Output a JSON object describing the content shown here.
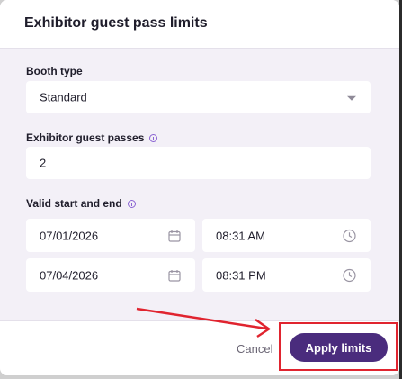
{
  "dialog": {
    "title": "Exhibitor guest pass limits"
  },
  "booth_type": {
    "label": "Booth type",
    "value": "Standard"
  },
  "guest_passes": {
    "label": "Exhibitor guest passes",
    "value": "2"
  },
  "validity": {
    "label": "Valid start and end",
    "start_date": "07/01/2026",
    "start_time": "08:31 AM",
    "end_date": "07/04/2026",
    "end_time": "08:31 PM"
  },
  "footer": {
    "cancel_label": "Cancel",
    "apply_label": "Apply limits"
  },
  "colors": {
    "primary": "#4a2c7d",
    "annotation": "#e0242f",
    "dialog_bg": "#f3f0f7"
  }
}
